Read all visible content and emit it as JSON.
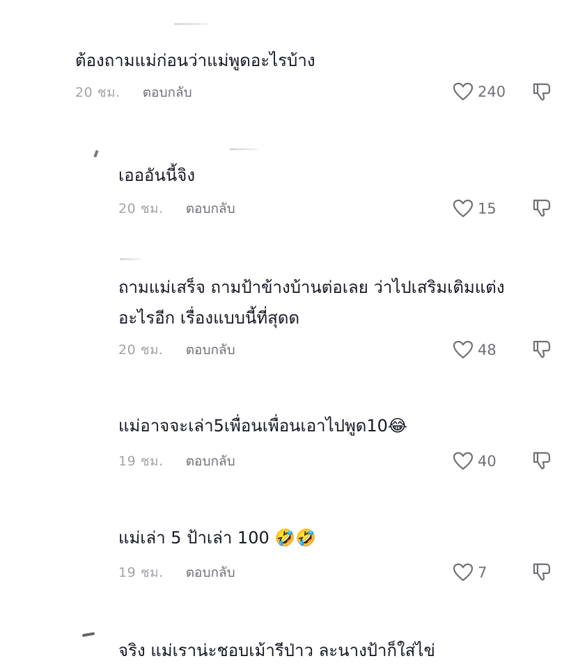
{
  "comments": [
    {
      "text": "ต้องถามแม่ก่อนว่าแม่พูดอะไรบ้าง",
      "time": "20 ชม.",
      "reply": "ตอบกลับ",
      "likes": "240"
    },
    {
      "text": "เอออันนี้จิง",
      "time": "20 ชม.",
      "reply": "ตอบกลับ",
      "likes": "15"
    },
    {
      "text_line1": "ถามแม่เสร็จ ถามป้าข้างบ้านต่อเลย ว่าไปเสริมเติมแต่ง",
      "text_line2": "อะไรอีก เรื่องแบบนี้ที่สุดด",
      "time": "20 ชม.",
      "reply": "ตอบกลับ",
      "likes": "48"
    },
    {
      "text": "แม่อาจจะเล่า5เพื่อนเพื่อนเอาไปพูด10",
      "emoji": "😂",
      "time": "19 ชม.",
      "reply": "ตอบกลับ",
      "likes": "40"
    },
    {
      "text": "แม่เล่า 5 ป้าเล่า 100 ",
      "emoji": "🤣🤣",
      "time": "19 ชม.",
      "reply": "ตอบกลับ",
      "likes": "7"
    },
    {
      "text": "จริง แม่เราน่ะชอบเม้ารีป่าว ละนางป้าก็ใส่ไข่"
    }
  ],
  "icons": {
    "like": "heart-outline-icon",
    "dislike": "thumbs-down-outline-icon"
  },
  "colors": {
    "text": "#161823",
    "muted": "#a3a3a8",
    "reply": "#6f6f76"
  }
}
